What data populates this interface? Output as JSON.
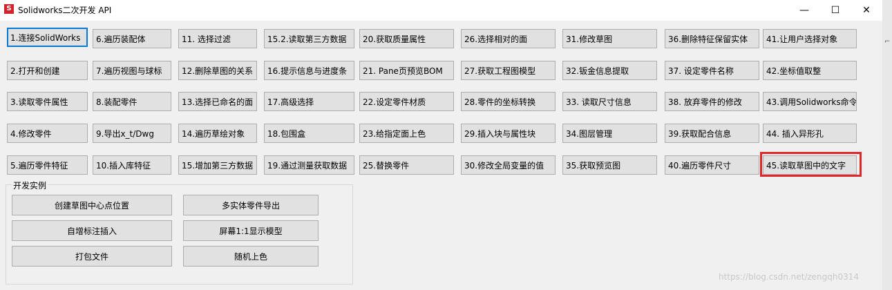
{
  "window": {
    "title": "Solidworks二次开发 API",
    "icon_letter": "S",
    "controls": {
      "minimize": "—",
      "maximize": "☐",
      "close": "✕"
    }
  },
  "buttons": {
    "col1": [
      "1.连接SolidWorks",
      "2.打开和创建",
      "3.读取零件属性",
      "4.修改零件",
      "5.遍历零件特征"
    ],
    "col2": [
      "6.遍历装配体",
      "7.遍历视图与球标",
      "8.装配零件",
      "9.导出x_t/Dwg",
      "10.插入库特征"
    ],
    "col3": [
      "11. 选择过滤",
      "12.删除草图的关系",
      "13.选择已命名的面",
      "14.遍历草绘对象",
      "15.增加第三方数据"
    ],
    "col4": [
      "15.2.读取第三方数据",
      "16.提示信息与进度条",
      "17.高级选择",
      "18.包围盒",
      "19.通过测量获取数据"
    ],
    "col5": [
      "20.获取质量属性",
      "21. Pane页预览BOM",
      "22.设定零件材质",
      "23.给指定面上色",
      "25.替换零件"
    ],
    "col6": [
      "26.选择相对的面",
      "27.获取工程图模型",
      "28.零件的坐标转换",
      "29.插入块与属性块",
      "30.修改全局变量的值"
    ],
    "col7": [
      "31.修改草图",
      "32.钣金信息提取",
      "33. 读取尺寸信息",
      "34.图层管理",
      "35.获取预览图"
    ],
    "col8": [
      "36.删除特征保留实体",
      "37. 设定零件名称",
      "38. 放弃零件的修改",
      "39.获取配合信息",
      "40.遍历零件尺寸"
    ],
    "col9": [
      "41.让用户选择对象",
      "42.坐标值取整",
      "43.调用Solidworks命令",
      "44. 插入异形孔",
      "45.读取草图中的文字"
    ]
  },
  "examples": {
    "label": "开发实例",
    "items": [
      "创建草图中心点位置",
      "多实体零件导出",
      "自增标注插入",
      "屏幕1:1显示模型",
      "打包文件",
      "随机上色"
    ]
  },
  "watermark": "https://blog.csdn.net/zengqh0314",
  "colors": {
    "highlight": "#e0262b",
    "focus": "#0078d7"
  }
}
